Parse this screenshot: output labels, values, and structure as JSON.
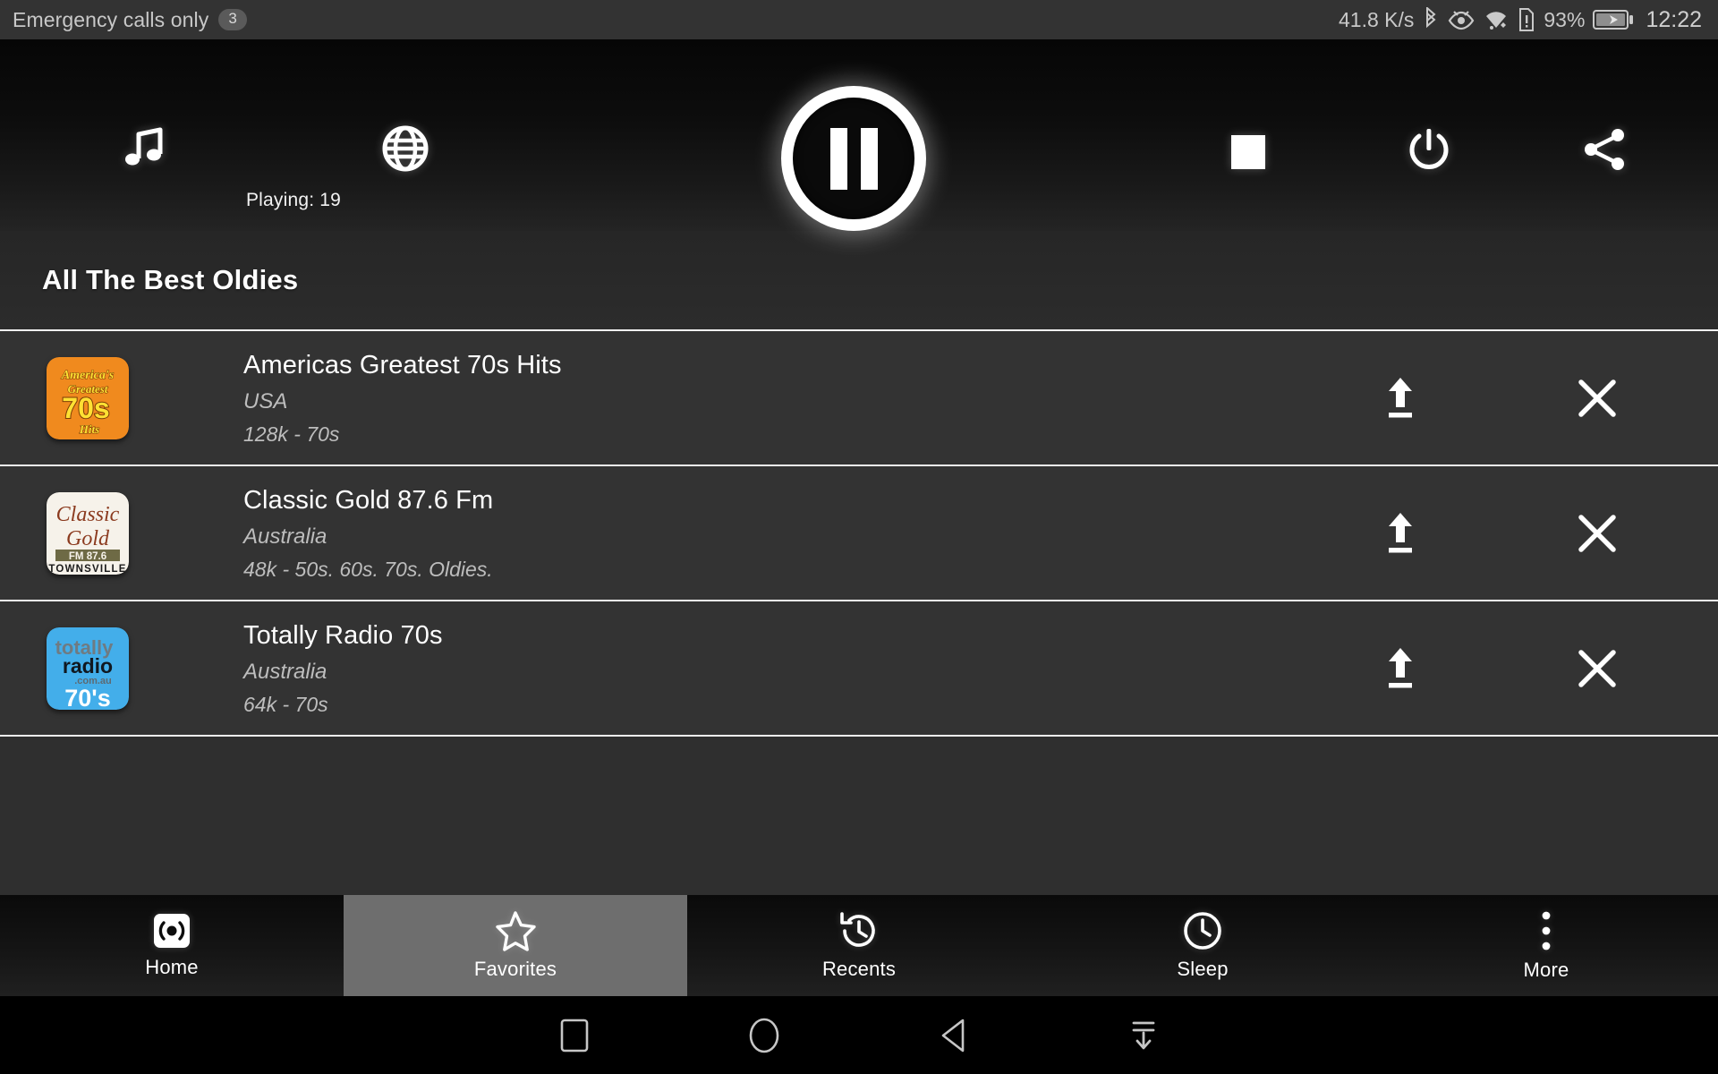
{
  "statusbar": {
    "carrier": "Emergency calls only",
    "notification_count": "3",
    "network_speed": "41.8 K/s",
    "battery_percent": "93%",
    "clock": "12:22",
    "icons": [
      "bluetooth-icon",
      "eye-icon",
      "wifi-icon",
      "sim-alert-icon",
      "battery-charging-icon"
    ]
  },
  "player": {
    "music_icon": "music-note-icon",
    "globe_icon": "globe-icon",
    "playing_label": "Playing: 19",
    "transport_state": "pause-button",
    "stop_icon": "stop-icon",
    "power_icon": "power-icon",
    "share_icon": "share-icon"
  },
  "section": {
    "title": "All The Best Oldies"
  },
  "stations": [
    {
      "name": "Americas Greatest 70s Hits",
      "country": "USA",
      "info": "128k - 70s",
      "logo": "americas-greatest-70s-hits-logo",
      "logo_bg": "#F08A1E",
      "logo_text_color": "#FFE033",
      "logo_lines": [
        "America's",
        "Greatest",
        "70s",
        "Hits"
      ],
      "upload_icon": "move-to-top-icon",
      "remove_icon": "remove-icon"
    },
    {
      "name": "Classic Gold 87.6 Fm",
      "country": "Australia",
      "info": "48k - 50s. 60s. 70s. Oldies.",
      "logo": "classic-gold-logo",
      "logo_bg": "#F6F2EA",
      "logo_text_color": "#8B3A1E",
      "logo_lines": [
        "Classic",
        "Gold",
        "FM 87.6",
        "TOWNSVILLE"
      ],
      "upload_icon": "move-to-top-icon",
      "remove_icon": "remove-icon"
    },
    {
      "name": "Totally Radio 70s",
      "country": "Australia",
      "info": "64k - 70s",
      "logo": "totally-radio-70s-logo",
      "logo_bg": "#43AEEA",
      "logo_text_color": "#FFFFFF",
      "logo_lines": [
        "totally",
        "radio",
        ".com.au",
        "70's"
      ],
      "upload_icon": "move-to-top-icon",
      "remove_icon": "remove-icon"
    }
  ],
  "tabs": [
    {
      "label": "Home",
      "icon": "radio-broadcast-icon",
      "selected": false
    },
    {
      "label": "Favorites",
      "icon": "star-icon",
      "selected": true
    },
    {
      "label": "Recents",
      "icon": "history-icon",
      "selected": false
    },
    {
      "label": "Sleep",
      "icon": "clock-icon",
      "selected": false
    },
    {
      "label": "More",
      "icon": "more-vertical-icon",
      "selected": false
    }
  ],
  "android_nav": [
    {
      "icon": "recents-square-icon"
    },
    {
      "icon": "home-circle-icon"
    },
    {
      "icon": "back-triangle-icon"
    },
    {
      "icon": "hide-navbar-icon"
    }
  ],
  "colors": {
    "app_background": "#333333",
    "statusbar_background": "#333333",
    "tab_selected": "#6E6E6E",
    "divider": "#F2F2F2",
    "accent_text": "#FFFFFF"
  }
}
